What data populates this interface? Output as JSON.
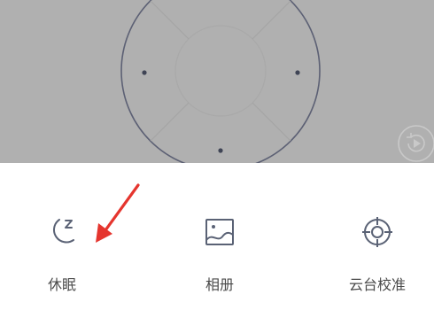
{
  "actions": [
    {
      "label": "休眠",
      "icon": "sleep-moon-icon"
    },
    {
      "label": "相册",
      "icon": "photo-album-icon"
    },
    {
      "label": "云台校准",
      "icon": "ptz-calibration-icon"
    }
  ],
  "icons": {
    "replay": "replay-icon",
    "pointer": "red-arrow-annotation"
  },
  "colors": {
    "panel_background": "#b0b0b0",
    "dial_stroke": "#5c6074",
    "icon_stroke": "#5a6275",
    "label_text": "#4a4a4a",
    "annotation_red": "#e5352e"
  }
}
